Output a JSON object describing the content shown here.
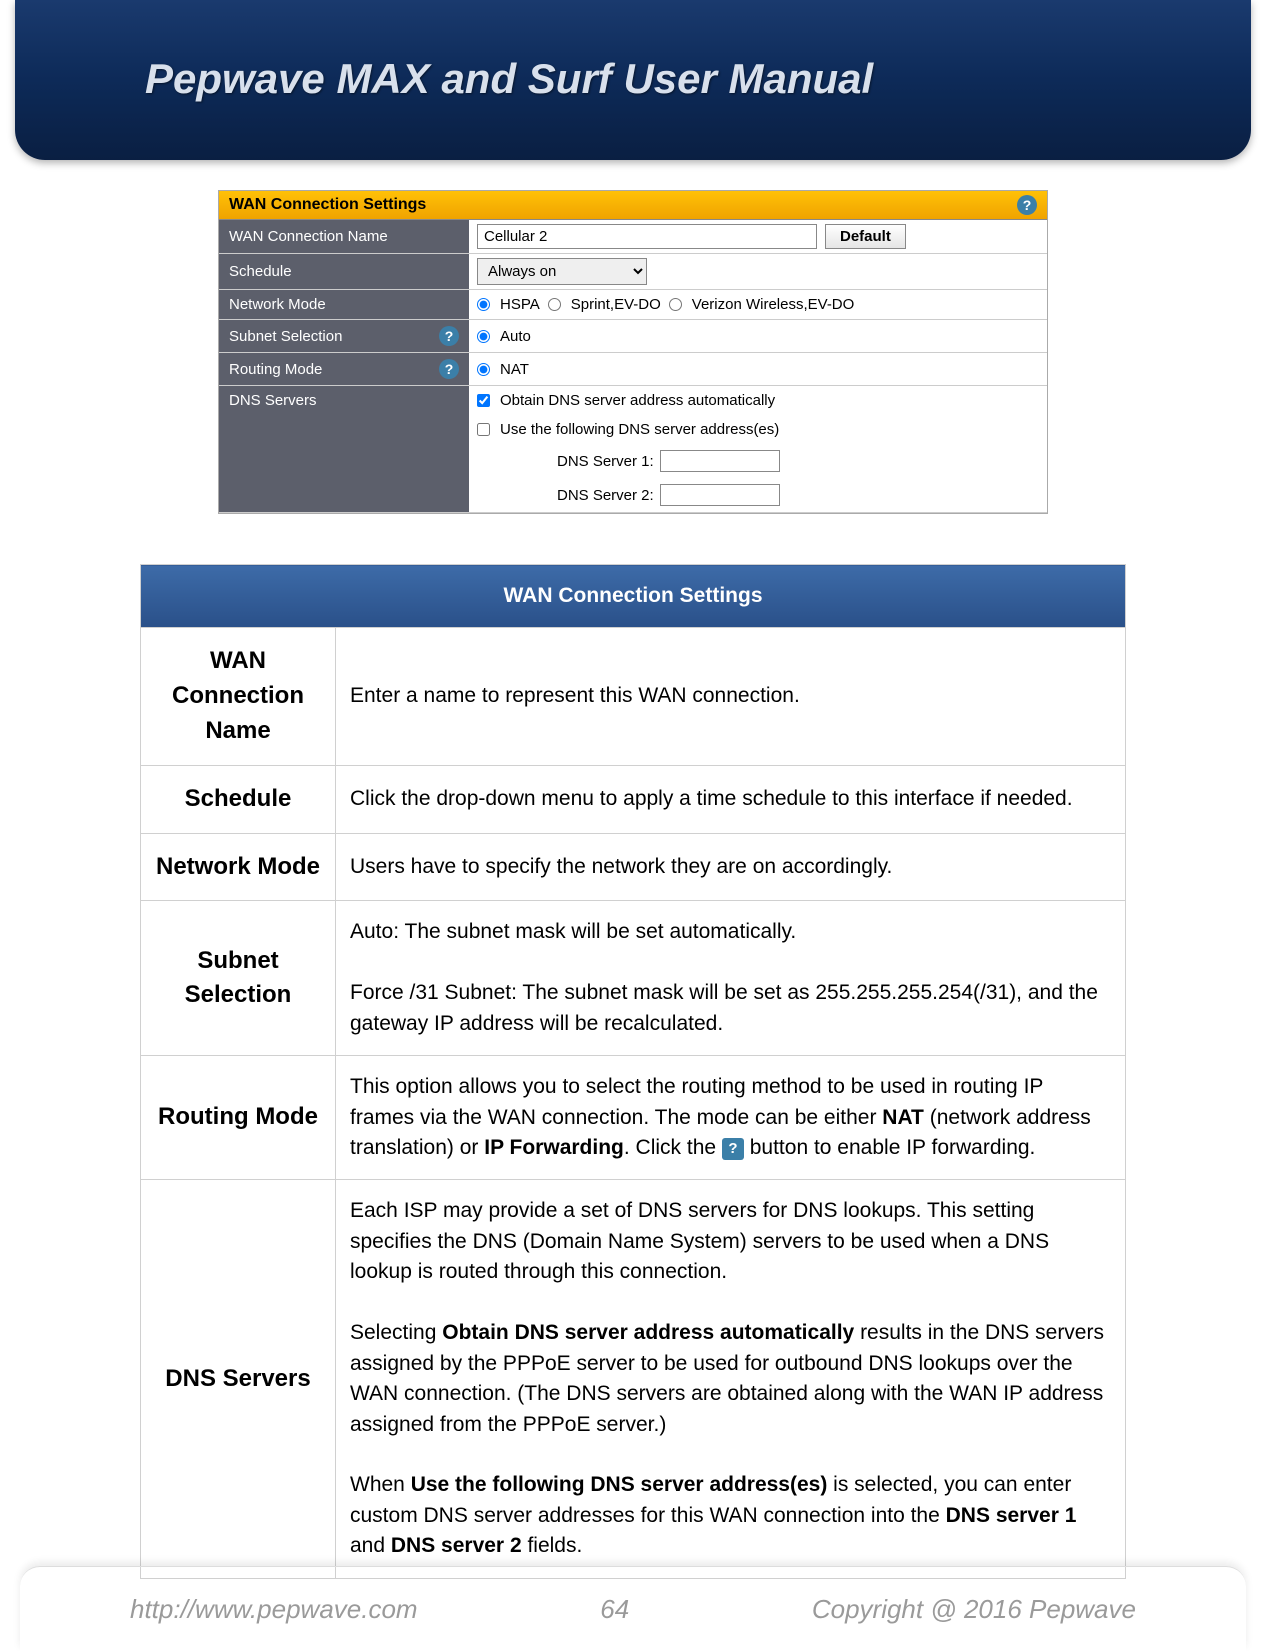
{
  "header": {
    "title": "Pepwave MAX and Surf User Manual"
  },
  "screenshot": {
    "panel_title": "WAN Connection Settings",
    "rows": {
      "wan_name": {
        "label": "WAN Connection Name",
        "value": "Cellular 2",
        "default_btn": "Default"
      },
      "schedule": {
        "label": "Schedule",
        "value": "Always on"
      },
      "network_mode": {
        "label": "Network Mode",
        "opt1": "HSPA",
        "opt2": "Sprint,EV-DO",
        "opt3": "Verizon Wireless,EV-DO"
      },
      "subnet": {
        "label": "Subnet Selection",
        "opt1": "Auto"
      },
      "routing": {
        "label": "Routing Mode",
        "opt1": "NAT"
      },
      "dns": {
        "label": "DNS Servers",
        "chk1": "Obtain DNS server address automatically",
        "chk2": "Use the following DNS server address(es)",
        "server1_label": "DNS Server 1:",
        "server2_label": "DNS Server 2:"
      }
    }
  },
  "doc_table": {
    "title": "WAN Connection Settings",
    "rows": [
      {
        "label": "WAN Connection Name",
        "desc": "Enter a name to represent this WAN connection."
      },
      {
        "label": "Schedule",
        "desc": "Click the drop-down menu to apply a time schedule to this interface if needed."
      },
      {
        "label": "Network Mode",
        "desc": "Users have to specify the network they are on accordingly."
      },
      {
        "label": "Subnet Selection",
        "desc_p1": "Auto: The subnet mask will be set automatically.",
        "desc_p2": "Force /31 Subnet: The subnet mask will be set as 255.255.255.254(/31), and the gateway IP address will be recalculated."
      },
      {
        "label": "Routing Mode",
        "desc_pre": "This option allows you to select the routing method to be used in routing IP frames via the WAN connection. The mode can be either ",
        "desc_b1": "NAT",
        "desc_mid1": " (network address translation) or ",
        "desc_b2": "IP Forwarding",
        "desc_mid2": ". Click the ",
        "desc_post": " button to enable IP forwarding."
      },
      {
        "label": "DNS Servers",
        "p1": "Each ISP may provide a set of DNS servers for DNS lookups. This setting specifies the DNS (Domain Name System) servers to be used when a DNS lookup is routed through this connection.",
        "p2_pre": "Selecting ",
        "p2_b": "Obtain DNS server address automatically",
        "p2_post": " results in the DNS servers assigned by the PPPoE server to be used for outbound DNS lookups over the WAN connection. (The DNS servers are obtained along with the WAN IP address assigned from the PPPoE server.)",
        "p3_pre": "When ",
        "p3_b1": "Use the following DNS server address(es)",
        "p3_mid1": " is selected, you can enter custom DNS server addresses for this WAN connection into the ",
        "p3_b2": "DNS server 1",
        "p3_mid2": " and ",
        "p3_b3": "DNS server 2",
        "p3_post": " fields."
      }
    ]
  },
  "footer": {
    "url": "http://www.pepwave.com",
    "page": "64",
    "copyright": "Copyright @ 2016 Pepwave"
  }
}
